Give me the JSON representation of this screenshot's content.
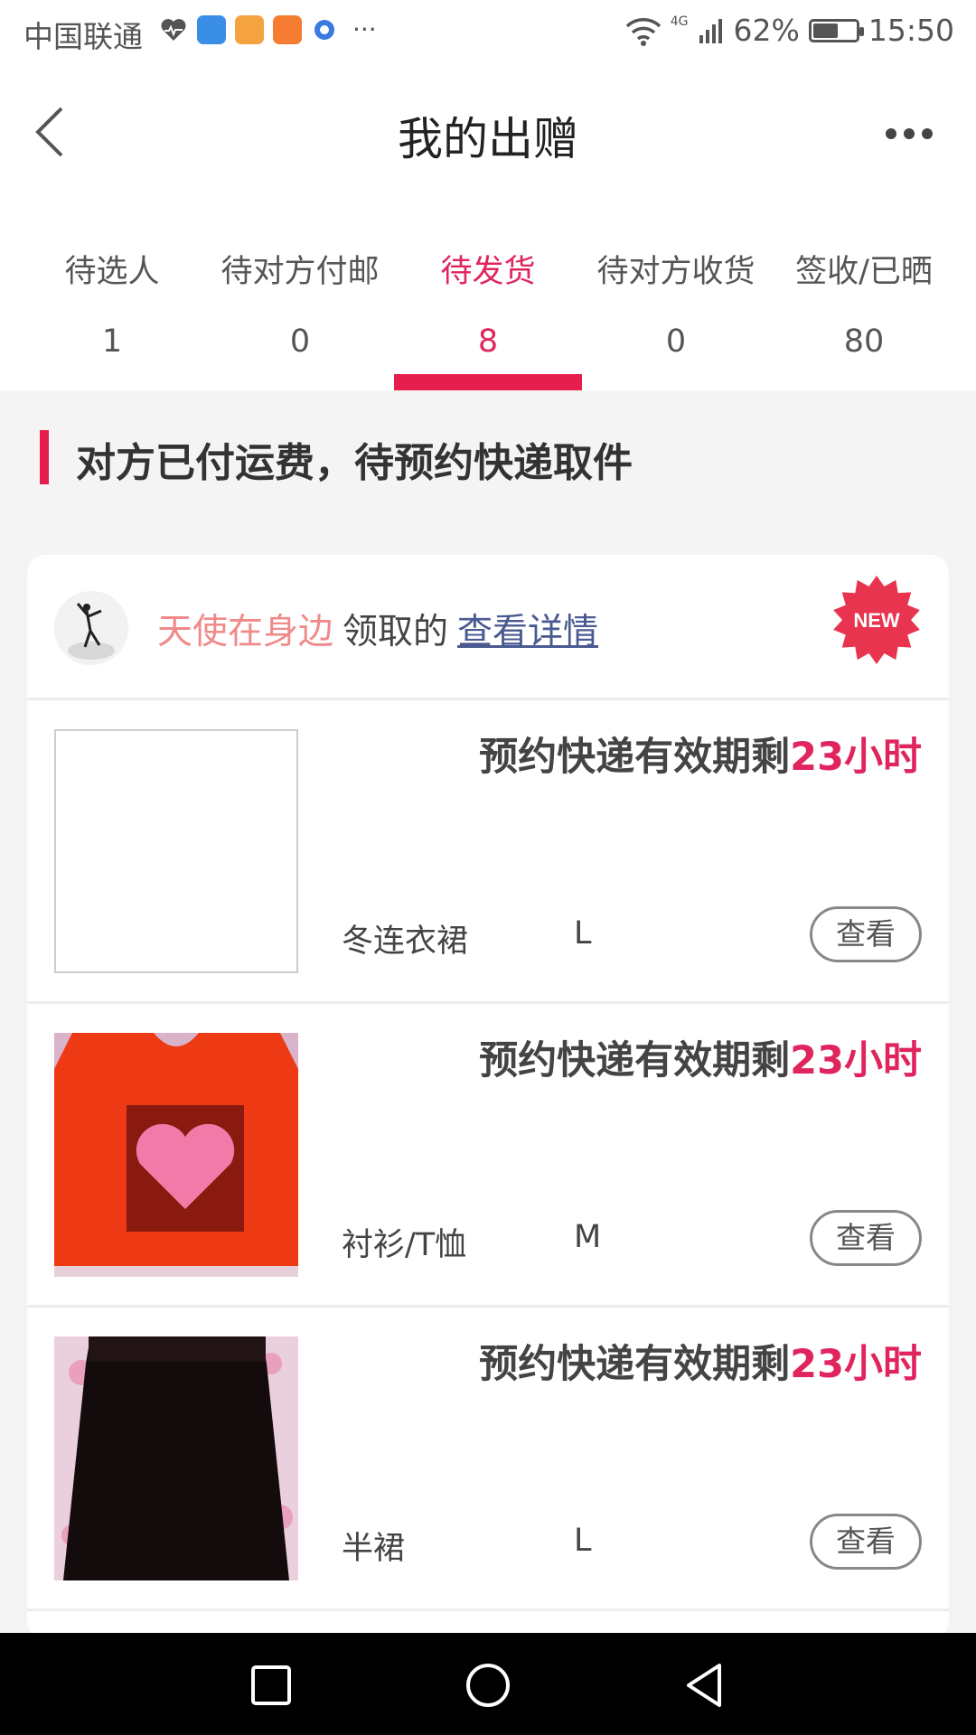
{
  "status_bar": {
    "carrier": "中国联通",
    "battery": "62%",
    "battery_level": 0.62,
    "network": "4G",
    "time": "15:50",
    "overflow": "···"
  },
  "header": {
    "title": "我的出赠"
  },
  "tabs": [
    {
      "label": "待选人",
      "count": "1"
    },
    {
      "label": "待对方付邮",
      "count": "0"
    },
    {
      "label": "待发货",
      "count": "8",
      "active": true
    },
    {
      "label": "待对方收货",
      "count": "0"
    },
    {
      "label": "签收/已晒",
      "count": "80"
    }
  ],
  "section": {
    "title": "对方已付运费，待预约快递取件"
  },
  "card": {
    "receiver_name": "天使在身边",
    "received_text": "领取的",
    "detail_link": "查看详情",
    "badge": "NEW",
    "items": [
      {
        "deadline_prefix": "预约快递有效期剩",
        "deadline_hours": "23小时",
        "category": "冬连衣裙",
        "size": "L",
        "view_label": "查看"
      },
      {
        "deadline_prefix": "预约快递有效期剩",
        "deadline_hours": "23小时",
        "category": "衬衫/T恤",
        "size": "M",
        "view_label": "查看"
      },
      {
        "deadline_prefix": "预约快递有效期剩",
        "deadline_hours": "23小时",
        "category": "半裙",
        "size": "L",
        "view_label": "查看"
      }
    ]
  },
  "colors": {
    "accent": "#e61e4d",
    "receiver_name": "#f08a8a",
    "link": "#4a5a90"
  }
}
